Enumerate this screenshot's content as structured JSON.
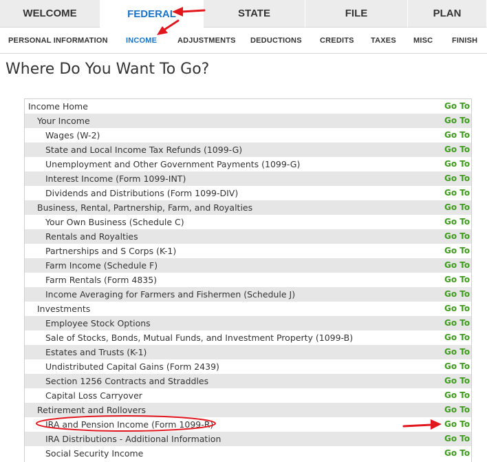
{
  "top_tabs": [
    {
      "label": "WELCOME",
      "active": false
    },
    {
      "label": "FEDERAL",
      "active": true
    },
    {
      "label": "STATE",
      "active": false
    },
    {
      "label": "FILE",
      "active": false
    },
    {
      "label": "PLAN",
      "active": false
    }
  ],
  "sub_tabs": [
    {
      "label": "PERSONAL INFORMATION",
      "active": false
    },
    {
      "label": "INCOME",
      "active": true
    },
    {
      "label": "ADJUSTMENTS",
      "active": false
    },
    {
      "label": "DEDUCTIONS",
      "active": false
    },
    {
      "label": "CREDITS",
      "active": false
    },
    {
      "label": "TAXES",
      "active": false
    },
    {
      "label": "MISC",
      "active": false
    },
    {
      "label": "FINISH",
      "active": false
    }
  ],
  "page_title": "Where Do You Want To Go?",
  "goto_label": "Go To",
  "rows": [
    {
      "label": "Income Home",
      "level": 0
    },
    {
      "label": "Your Income",
      "level": 1
    },
    {
      "label": "Wages (W-2)",
      "level": 2
    },
    {
      "label": "State and Local Income Tax Refunds (1099-G)",
      "level": 2
    },
    {
      "label": "Unemployment and Other Government Payments (1099-G)",
      "level": 2
    },
    {
      "label": "Interest Income (Form 1099-INT)",
      "level": 2
    },
    {
      "label": "Dividends and Distributions (Form 1099-DIV)",
      "level": 2
    },
    {
      "label": "Business, Rental, Partnership, Farm, and Royalties",
      "level": 1
    },
    {
      "label": "Your Own Business (Schedule C)",
      "level": 2
    },
    {
      "label": "Rentals and Royalties",
      "level": 2
    },
    {
      "label": "Partnerships and S Corps (K-1)",
      "level": 2
    },
    {
      "label": "Farm Income (Schedule F)",
      "level": 2
    },
    {
      "label": "Farm Rentals (Form 4835)",
      "level": 2
    },
    {
      "label": "Income Averaging for Farmers and Fishermen (Schedule J)",
      "level": 2
    },
    {
      "label": "Investments",
      "level": 1
    },
    {
      "label": "Employee Stock Options",
      "level": 2
    },
    {
      "label": "Sale of Stocks, Bonds, Mutual Funds, and Investment Property (1099-B)",
      "level": 2
    },
    {
      "label": "Estates and Trusts (K-1)",
      "level": 2
    },
    {
      "label": "Undistributed Capital Gains (Form 2439)",
      "level": 2
    },
    {
      "label": "Section 1256 Contracts and Straddles",
      "level": 2
    },
    {
      "label": "Capital Loss Carryover",
      "level": 2
    },
    {
      "label": "Retirement and Rollovers",
      "level": 1
    },
    {
      "label": "IRA and Pension Income (Form 1099-R)",
      "level": 2
    },
    {
      "label": "IRA Distributions - Additional Information",
      "level": 2
    },
    {
      "label": "Social Security Income",
      "level": 2
    }
  ],
  "annotation_color": "#e2161d"
}
